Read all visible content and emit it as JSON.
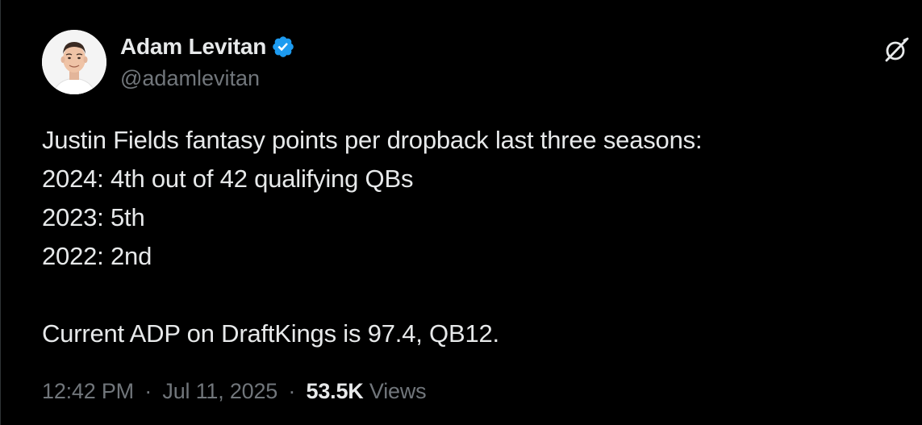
{
  "author": {
    "name": "Adam Levitan",
    "handle": "@adamlevitan",
    "verified_icon": "verified-badge-icon",
    "avatar_icon": "avatar"
  },
  "tweet": {
    "lines": [
      "Justin Fields fantasy points per dropback last three seasons:",
      "2024: 4th out of 42 qualifying QBs",
      "2023: 5th",
      "2022: 2nd",
      "",
      "Current ADP on DraftKings is 97.4, QB12."
    ]
  },
  "meta": {
    "time": "12:42 PM",
    "separator": "·",
    "date": "Jul 11, 2025",
    "views_count": "53.5K",
    "views_label": "Views"
  },
  "actions": {
    "grok_icon": "grok-icon"
  },
  "colors": {
    "background": "#000000",
    "text_primary": "#e7e9ea",
    "text_secondary": "#71767b",
    "verified_blue": "#1d9bf0"
  }
}
